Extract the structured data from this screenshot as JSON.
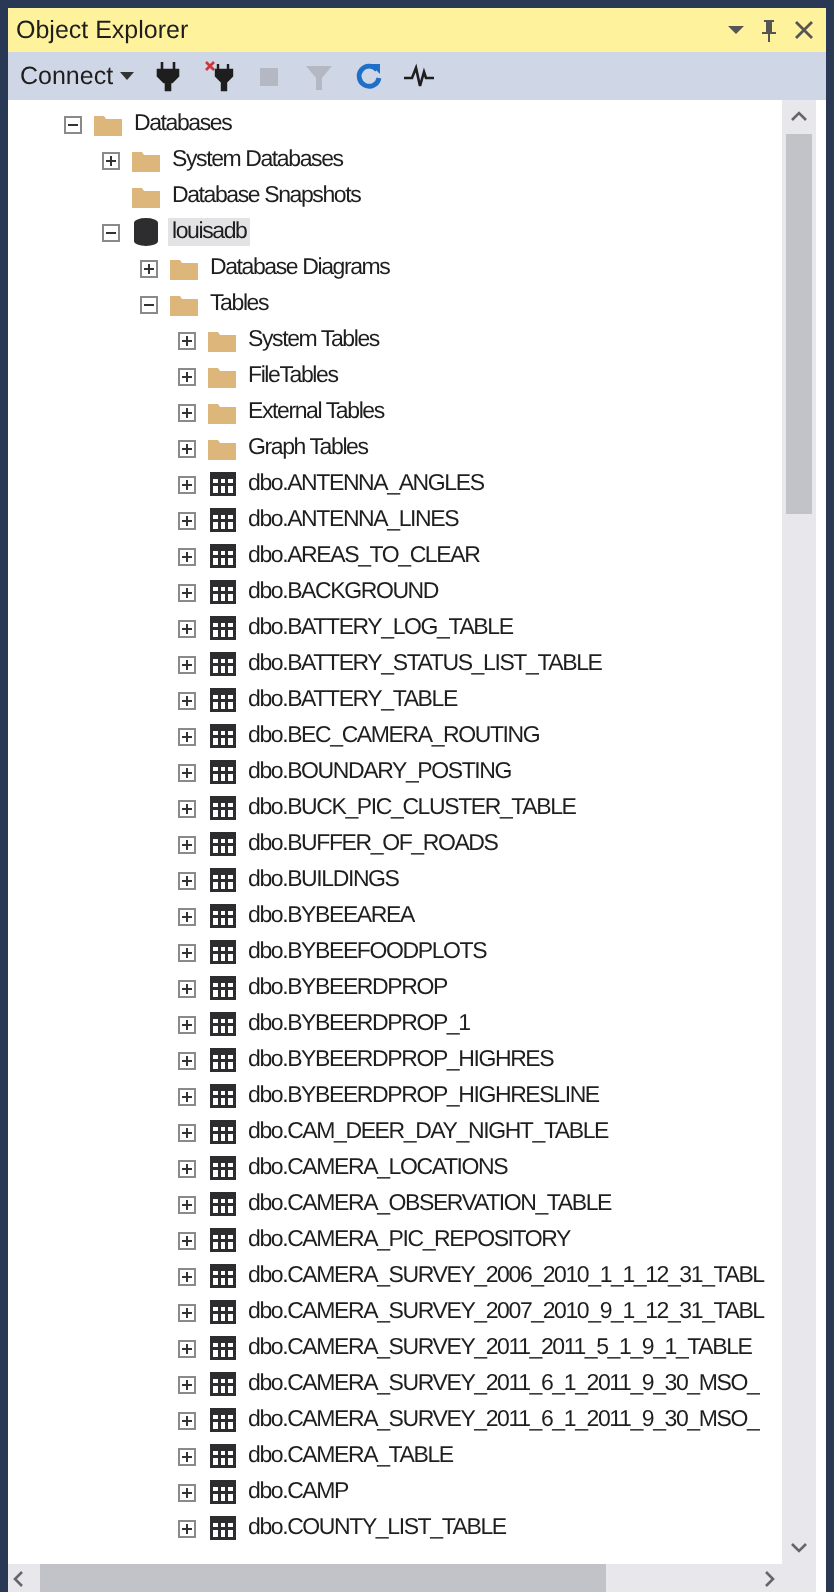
{
  "panel": {
    "title": "Object Explorer"
  },
  "toolbar": {
    "connect": "Connect",
    "buttons": [
      {
        "kind": "connect",
        "disabled": false
      },
      {
        "kind": "disconnect",
        "disabled": false
      },
      {
        "kind": "stop",
        "disabled": true
      },
      {
        "kind": "filter",
        "disabled": true
      },
      {
        "kind": "refresh",
        "disabled": false
      },
      {
        "kind": "activity",
        "disabled": false
      }
    ]
  },
  "tree": [
    {
      "label": "Databases",
      "kind": "folder",
      "expandable": true,
      "expanded": true,
      "selected": false,
      "children": [
        {
          "label": "System Databases",
          "kind": "folder",
          "expandable": true,
          "expanded": false,
          "selected": false
        },
        {
          "label": "Database Snapshots",
          "kind": "folder",
          "expandable": false,
          "selected": false
        },
        {
          "label": "louisadb",
          "kind": "database",
          "expandable": true,
          "expanded": true,
          "selected": true,
          "children": [
            {
              "label": "Database Diagrams",
              "kind": "folder",
              "expandable": true,
              "expanded": false,
              "selected": false
            },
            {
              "label": "Tables",
              "kind": "folder",
              "expandable": true,
              "expanded": true,
              "selected": false,
              "children": [
                {
                  "label": "System Tables",
                  "kind": "folder",
                  "expandable": true,
                  "expanded": false,
                  "selected": false
                },
                {
                  "label": "FileTables",
                  "kind": "folder",
                  "expandable": true,
                  "expanded": false,
                  "selected": false
                },
                {
                  "label": "External Tables",
                  "kind": "folder",
                  "expandable": true,
                  "expanded": false,
                  "selected": false
                },
                {
                  "label": "Graph Tables",
                  "kind": "folder",
                  "expandable": true,
                  "expanded": false,
                  "selected": false
                },
                {
                  "label": "dbo.ANTENNA_ANGLES",
                  "kind": "table",
                  "expandable": true,
                  "expanded": false,
                  "selected": false
                },
                {
                  "label": "dbo.ANTENNA_LINES",
                  "kind": "table",
                  "expandable": true,
                  "expanded": false,
                  "selected": false
                },
                {
                  "label": "dbo.AREAS_TO_CLEAR",
                  "kind": "table",
                  "expandable": true,
                  "expanded": false,
                  "selected": false
                },
                {
                  "label": "dbo.BACKGROUND",
                  "kind": "table",
                  "expandable": true,
                  "expanded": false,
                  "selected": false
                },
                {
                  "label": "dbo.BATTERY_LOG_TABLE",
                  "kind": "table",
                  "expandable": true,
                  "expanded": false,
                  "selected": false
                },
                {
                  "label": "dbo.BATTERY_STATUS_LIST_TABLE",
                  "kind": "table",
                  "expandable": true,
                  "expanded": false,
                  "selected": false
                },
                {
                  "label": "dbo.BATTERY_TABLE",
                  "kind": "table",
                  "expandable": true,
                  "expanded": false,
                  "selected": false
                },
                {
                  "label": "dbo.BEC_CAMERA_ROUTING",
                  "kind": "table",
                  "expandable": true,
                  "expanded": false,
                  "selected": false
                },
                {
                  "label": "dbo.BOUNDARY_POSTING",
                  "kind": "table",
                  "expandable": true,
                  "expanded": false,
                  "selected": false
                },
                {
                  "label": "dbo.BUCK_PIC_CLUSTER_TABLE",
                  "kind": "table",
                  "expandable": true,
                  "expanded": false,
                  "selected": false
                },
                {
                  "label": "dbo.BUFFER_OF_ROADS",
                  "kind": "table",
                  "expandable": true,
                  "expanded": false,
                  "selected": false
                },
                {
                  "label": "dbo.BUILDINGS",
                  "kind": "table",
                  "expandable": true,
                  "expanded": false,
                  "selected": false
                },
                {
                  "label": "dbo.BYBEEAREA",
                  "kind": "table",
                  "expandable": true,
                  "expanded": false,
                  "selected": false
                },
                {
                  "label": "dbo.BYBEEFOODPLOTS",
                  "kind": "table",
                  "expandable": true,
                  "expanded": false,
                  "selected": false
                },
                {
                  "label": "dbo.BYBEERDPROP",
                  "kind": "table",
                  "expandable": true,
                  "expanded": false,
                  "selected": false
                },
                {
                  "label": "dbo.BYBEERDPROP_1",
                  "kind": "table",
                  "expandable": true,
                  "expanded": false,
                  "selected": false
                },
                {
                  "label": "dbo.BYBEERDPROP_HIGHRES",
                  "kind": "table",
                  "expandable": true,
                  "expanded": false,
                  "selected": false
                },
                {
                  "label": "dbo.BYBEERDPROP_HIGHRESLINE",
                  "kind": "table",
                  "expandable": true,
                  "expanded": false,
                  "selected": false
                },
                {
                  "label": "dbo.CAM_DEER_DAY_NIGHT_TABLE",
                  "kind": "table",
                  "expandable": true,
                  "expanded": false,
                  "selected": false
                },
                {
                  "label": "dbo.CAMERA_LOCATIONS",
                  "kind": "table",
                  "expandable": true,
                  "expanded": false,
                  "selected": false
                },
                {
                  "label": "dbo.CAMERA_OBSERVATION_TABLE",
                  "kind": "table",
                  "expandable": true,
                  "expanded": false,
                  "selected": false
                },
                {
                  "label": "dbo.CAMERA_PIC_REPOSITORY",
                  "kind": "table",
                  "expandable": true,
                  "expanded": false,
                  "selected": false
                },
                {
                  "label": "dbo.CAMERA_SURVEY_2006_2010_1_1_12_31_TABL",
                  "kind": "table",
                  "expandable": true,
                  "expanded": false,
                  "selected": false
                },
                {
                  "label": "dbo.CAMERA_SURVEY_2007_2010_9_1_12_31_TABL",
                  "kind": "table",
                  "expandable": true,
                  "expanded": false,
                  "selected": false
                },
                {
                  "label": "dbo.CAMERA_SURVEY_2011_2011_5_1_9_1_TABLE",
                  "kind": "table",
                  "expandable": true,
                  "expanded": false,
                  "selected": false
                },
                {
                  "label": "dbo.CAMERA_SURVEY_2011_6_1_2011_9_30_MSO_",
                  "kind": "table",
                  "expandable": true,
                  "expanded": false,
                  "selected": false
                },
                {
                  "label": "dbo.CAMERA_SURVEY_2011_6_1_2011_9_30_MSO_",
                  "kind": "table",
                  "expandable": true,
                  "expanded": false,
                  "selected": false
                },
                {
                  "label": "dbo.CAMERA_TABLE",
                  "kind": "table",
                  "expandable": true,
                  "expanded": false,
                  "selected": false
                },
                {
                  "label": "dbo.CAMP",
                  "kind": "table",
                  "expandable": true,
                  "expanded": false,
                  "selected": false
                },
                {
                  "label": "dbo.COUNTY_LIST_TABLE",
                  "kind": "table",
                  "expandable": true,
                  "expanded": false,
                  "selected": false
                }
              ]
            }
          ]
        }
      ]
    }
  ]
}
